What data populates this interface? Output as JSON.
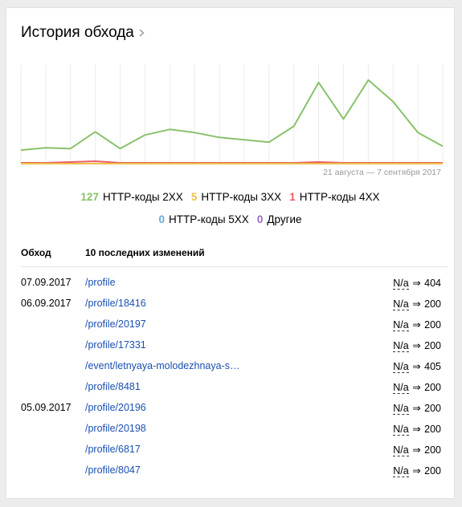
{
  "title": "История обхода",
  "chart_data": {
    "type": "line",
    "x_range_label": "21 августа — 7 сентября 2017",
    "series": [
      {
        "name": "HTTP-коды 2XX",
        "color": "#88c26a",
        "values": [
          17,
          20,
          19,
          40,
          19,
          36,
          43,
          39,
          33,
          30,
          27,
          47,
          102,
          56,
          105,
          78,
          39,
          22
        ]
      },
      {
        "name": "HTTP-коды 3XX",
        "color": "#f0c04d",
        "values": [
          0,
          0,
          0,
          0,
          0,
          0,
          0,
          0,
          0,
          0,
          0,
          0,
          0,
          0,
          0,
          0,
          0,
          0
        ]
      },
      {
        "name": "HTTP-коды 4XX",
        "color": "#e86060",
        "values": [
          1,
          1,
          2,
          3,
          1,
          1,
          1,
          1,
          1,
          1,
          1,
          1,
          2,
          1,
          1,
          1,
          1,
          1
        ]
      },
      {
        "name": "HTTP-коды 5XX",
        "color": "#6aa9d6",
        "values": [
          0,
          0,
          0,
          0,
          0,
          0,
          0,
          0,
          0,
          0,
          0,
          0,
          0,
          0,
          0,
          0,
          0,
          0
        ]
      },
      {
        "name": "Другие",
        "color": "#9966cc",
        "values": [
          0,
          0,
          0,
          0,
          0,
          0,
          0,
          0,
          0,
          0,
          0,
          0,
          0,
          0,
          0,
          0,
          0,
          0
        ]
      }
    ],
    "ylim": [
      0,
      125
    ]
  },
  "legend": [
    {
      "count": "127",
      "label": "HTTP-коды 2XX",
      "color": "#88c26a"
    },
    {
      "count": "5",
      "label": "HTTP-коды 3XX",
      "color": "#f0c04d"
    },
    {
      "count": "1",
      "label": "HTTP-коды 4XX",
      "color": "#e86060"
    },
    {
      "count": "0",
      "label": "HTTP-коды 5XX",
      "color": "#6aa9d6"
    },
    {
      "count": "0",
      "label": "Другие",
      "color": "#9966cc"
    }
  ],
  "table": {
    "col_date": "Обход",
    "col_changes": "10 последних изменений",
    "rows": [
      {
        "date": "07.09.2017",
        "path": "/profile",
        "from": "N/a",
        "arrow": "⇒",
        "to": "404"
      },
      {
        "date": "06.09.2017",
        "path": "/profile/18416",
        "from": "N/a",
        "arrow": "⇒",
        "to": "200"
      },
      {
        "date": "",
        "path": "/profile/20197",
        "from": "N/a",
        "arrow": "⇒",
        "to": "200"
      },
      {
        "date": "",
        "path": "/profile/17331",
        "from": "N/a",
        "arrow": "⇒",
        "to": "200"
      },
      {
        "date": "",
        "path": "/event/letnyaya-molodezhnaya-s…",
        "from": "N/a",
        "arrow": "⇒",
        "to": "405"
      },
      {
        "date": "",
        "path": "/profile/8481",
        "from": "N/a",
        "arrow": "⇒",
        "to": "200"
      },
      {
        "date": "05.09.2017",
        "path": "/profile/20196",
        "from": "N/a",
        "arrow": "⇒",
        "to": "200"
      },
      {
        "date": "",
        "path": "/profile/20198",
        "from": "N/a",
        "arrow": "⇒",
        "to": "200"
      },
      {
        "date": "",
        "path": "/profile/6817",
        "from": "N/a",
        "arrow": "⇒",
        "to": "200"
      },
      {
        "date": "",
        "path": "/profile/8047",
        "from": "N/a",
        "arrow": "⇒",
        "to": "200"
      }
    ]
  }
}
